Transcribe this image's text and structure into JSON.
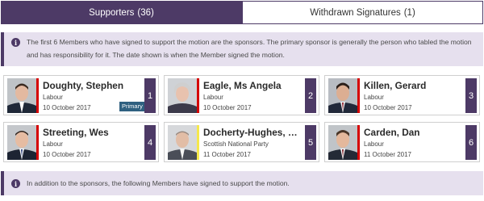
{
  "tabs": {
    "supporters_label": "Supporters",
    "supporters_count": "(36)",
    "withdrawn_label": "Withdrawn Signatures",
    "withdrawn_count": "(1)"
  },
  "notices": {
    "sponsors_info": "The first 6 Members who have signed to support the motion are the sponsors. The primary sponsor is generally the person who tabled the motion and has responsibility for it. The date shown is when the Member signed the motion.",
    "others_info": "In addition to the sponsors, the following Members have signed to support the motion."
  },
  "icons": {
    "info": "info-icon",
    "info_glyph": "i"
  },
  "colors": {
    "accent": "#4d3a66",
    "notice_bg": "#e6e0ee",
    "primary_badge": "#2f6080",
    "labour": "#d50000",
    "snp": "#f5e84b"
  },
  "members": [
    {
      "name": "Doughty, Stephen",
      "party": "Labour",
      "date": "10 October 2017",
      "number": "1",
      "badge": "Primary",
      "party_color": "#d50000"
    },
    {
      "name": "Eagle, Ms Angela",
      "party": "Labour",
      "date": "10 October 2017",
      "number": "2",
      "badge": "",
      "party_color": "#d50000"
    },
    {
      "name": "Killen, Gerard",
      "party": "Labour",
      "date": "10 October 2017",
      "number": "3",
      "badge": "",
      "party_color": "#d50000"
    },
    {
      "name": "Streeting, Wes",
      "party": "Labour",
      "date": "10 October 2017",
      "number": "4",
      "badge": "",
      "party_color": "#d50000"
    },
    {
      "name": "Docherty-Hughes, Martin",
      "party": "Scottish National Party",
      "date": "11 October 2017",
      "number": "5",
      "badge": "",
      "party_color": "#f5e84b"
    },
    {
      "name": "Carden, Dan",
      "party": "Labour",
      "date": "11 October 2017",
      "number": "6",
      "badge": "",
      "party_color": "#d50000"
    }
  ]
}
